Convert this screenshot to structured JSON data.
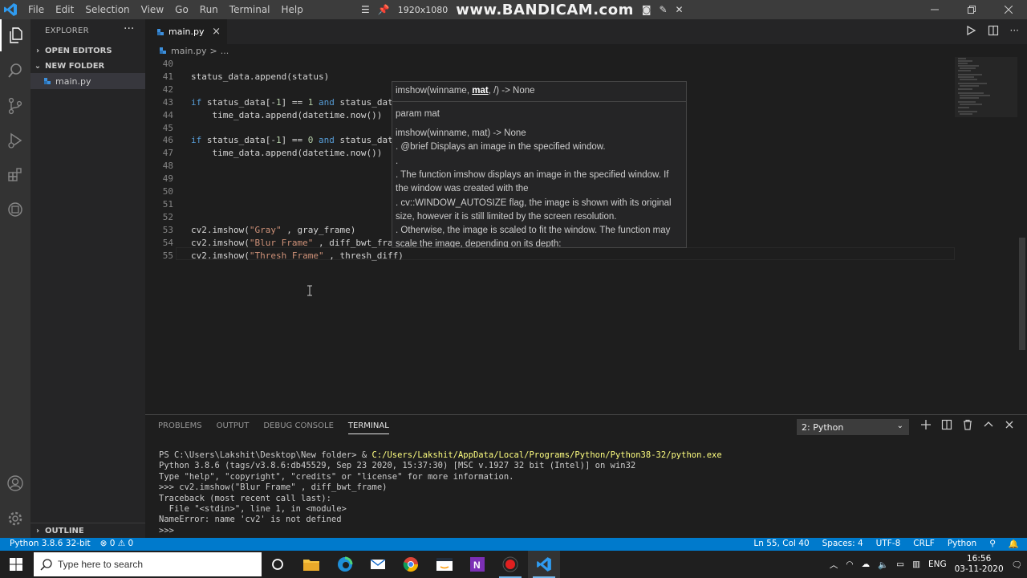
{
  "titlebar": {
    "menus": [
      "File",
      "Edit",
      "Selection",
      "View",
      "Go",
      "Run",
      "Terminal",
      "Help"
    ],
    "resolution": "1920x1080",
    "watermark": "www.BANDICAM.com"
  },
  "sidebar": {
    "header": "EXPLORER",
    "dots": "···",
    "open_editors": "OPEN EDITORS",
    "folder": "NEW FOLDER",
    "file": "main.py",
    "outline": "OUTLINE"
  },
  "tab": {
    "label": "main.py",
    "close": "×"
  },
  "breadcrumb": {
    "file": "main.py",
    "sep": ">",
    "rest": "..."
  },
  "editor": {
    "lines": [
      {
        "n": "40",
        "html": ""
      },
      {
        "n": "41",
        "html": "status_data.append(status)"
      },
      {
        "n": "42",
        "html": ""
      },
      {
        "n": "43",
        "html": "if status_data[-1] == 1 and status_data"
      },
      {
        "n": "44",
        "html": "    time_data.append(datetime.now())"
      },
      {
        "n": "45",
        "html": ""
      },
      {
        "n": "46",
        "html": "if status_data[-1] == 0 and status_data"
      },
      {
        "n": "47",
        "html": "    time_data.append(datetime.now())"
      },
      {
        "n": "48",
        "html": ""
      },
      {
        "n": "49",
        "html": ""
      },
      {
        "n": "50",
        "html": ""
      },
      {
        "n": "51",
        "html": ""
      },
      {
        "n": "52",
        "html": ""
      },
      {
        "n": "53",
        "html": "cv2.imshow(\"Gray\" , gray_frame)"
      },
      {
        "n": "54",
        "html": "cv2.imshow(\"Blur Frame\" , diff_bwt_fram"
      },
      {
        "n": "55",
        "html": "cv2.imshow(\"Thresh Frame\" , thresh_diff)"
      }
    ]
  },
  "hover": {
    "sig_pre": "imshow(winname, ",
    "sig_param": "mat",
    "sig_post": ", /) -> None",
    "param": "param mat",
    "lines": [
      "imshow(winname, mat) -> None",
      ".   @brief Displays an image in the specified window.",
      ".",
      ".   The function imshow displays an image in the specified window. If",
      "the window was created with the",
      ".   cv::WINDOW_AUTOSIZE flag, the image is shown with its original",
      "size, however it is still limited by the screen resolution.",
      ".   Otherwise, the image is scaled to fit the window. The function may",
      "scale the image, depending on its depth:"
    ]
  },
  "panel": {
    "tabs": [
      "PROBLEMS",
      "OUTPUT",
      "DEBUG CONSOLE",
      "TERMINAL"
    ],
    "active_tab": "TERMINAL",
    "terminal_select": "2: Python",
    "terminal": {
      "prompt": "PS C:\\Users\\Lakshit\\Desktop\\New folder> & ",
      "exe": "C:/Users/Lakshit/AppData/Local/Programs/Python/Python38-32/python.exe",
      "lines": [
        "Python 3.8.6 (tags/v3.8.6:db45529, Sep 23 2020, 15:37:30) [MSC v.1927 32 bit (Intel)] on win32",
        "Type \"help\", \"copyright\", \"credits\" or \"license\" for more information.",
        ">>> cv2.imshow(\"Blur Frame\" , diff_bwt_frame)",
        "Traceback (most recent call last):",
        "  File \"<stdin>\", line 1, in <module>",
        "NameError: name 'cv2' is not defined",
        ">>>"
      ]
    }
  },
  "statusbar": {
    "python": "Python 3.8.6 32-bit",
    "problems": "⊗ 0 ⚠ 0",
    "position": "Ln 55, Col 40",
    "spaces": "Spaces: 4",
    "encoding": "UTF-8",
    "eol": "CRLF",
    "language": "Python"
  },
  "taskbar": {
    "search_placeholder": "Type here to search",
    "lang": "ENG",
    "time": "16:56",
    "date": "03-11-2020"
  },
  "colors": {
    "accent": "#007acc",
    "keyword": "#569cd6",
    "string": "#ce9178",
    "number": "#b5cea8"
  }
}
